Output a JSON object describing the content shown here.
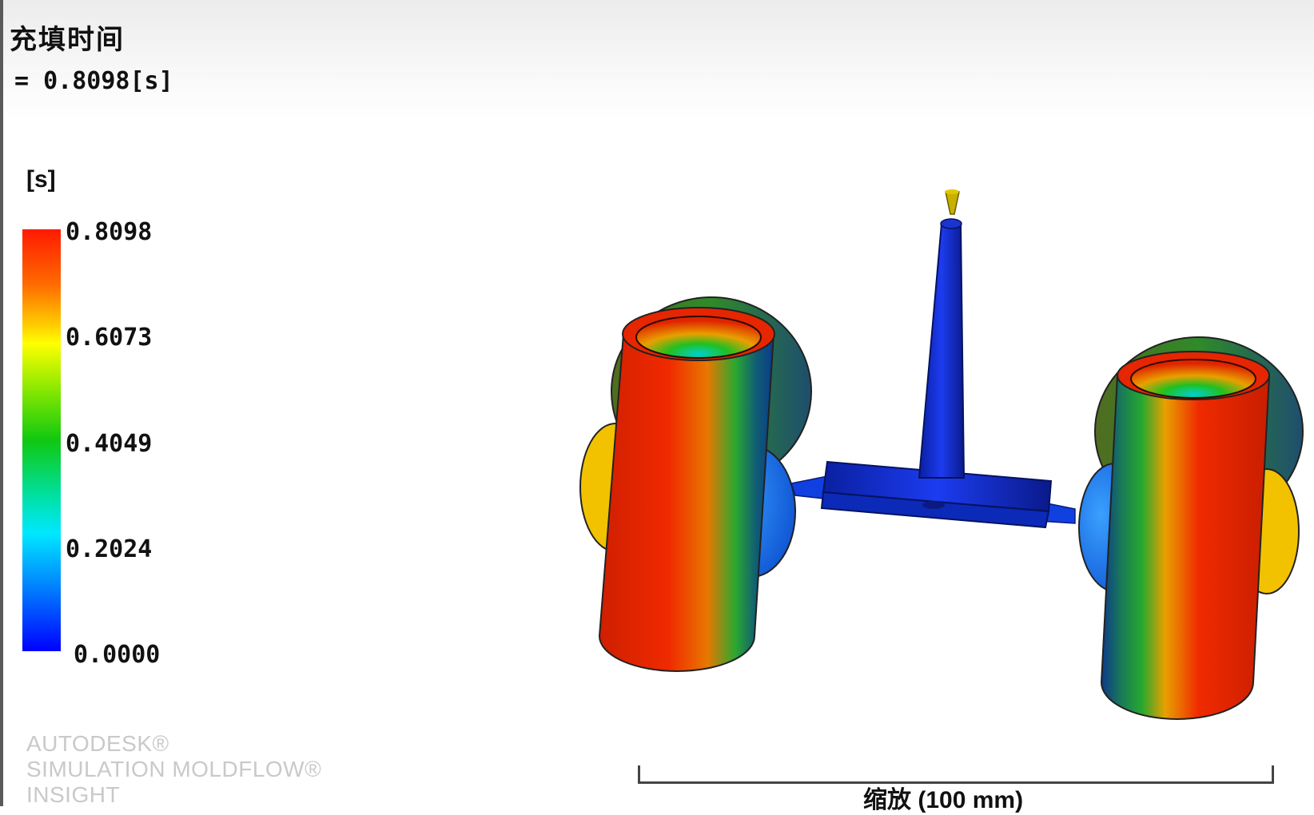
{
  "result": {
    "title": "充填时间",
    "value": "= 0.8098[s]"
  },
  "legend": {
    "unit": "[s]",
    "ticks": [
      "0.8098",
      "0.6073",
      "0.4049",
      "0.2024",
      "0.0000"
    ],
    "colors": {
      "max": "#ff1a00",
      "upper": "#ffff00",
      "mid": "#10c810",
      "lower": "#00e8ff",
      "min": "#0000ff"
    }
  },
  "branding": {
    "line1": "AUTODESK®",
    "line2": "SIMULATION MOLDFLOW®",
    "line3": "INSIGHT"
  },
  "scale": {
    "label": "缩放 (100 mm)"
  }
}
